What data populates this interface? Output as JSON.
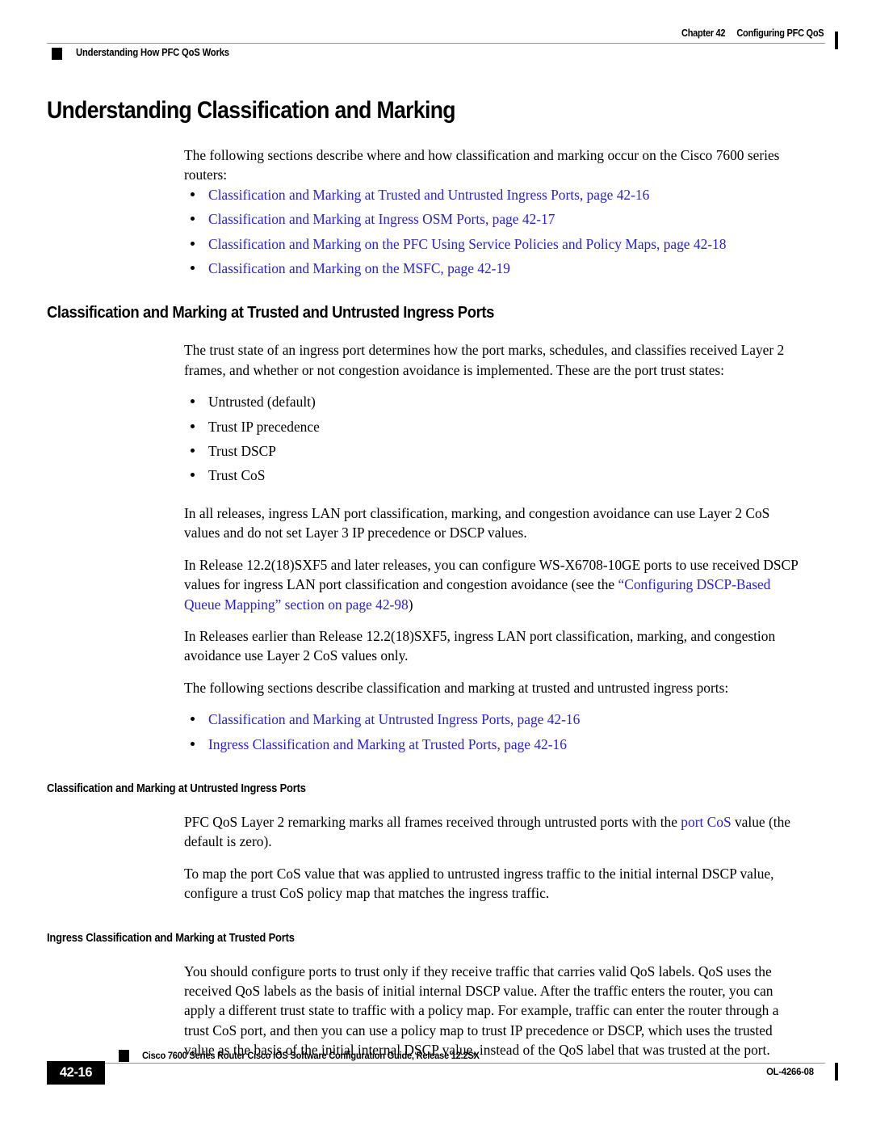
{
  "header": {
    "left_text": "Understanding How PFC QoS Works",
    "chapter_number": "Chapter 42",
    "chapter_title": "Configuring PFC QoS"
  },
  "footer": {
    "page_number": "42-16",
    "guide_title": "Cisco 7600 Series Router Cisco IOS Software Configuration Guide, Release 12.2SX",
    "doc_id": "OL-4266-08"
  },
  "main": {
    "section_title": "Understanding Classification and Marking",
    "intro_paragraph": "The following sections describe where and how classification and marking occur on the Cisco 7600 series routers:",
    "intro_links": [
      "Classification and Marking at Trusted and Untrusted Ingress Ports, page 42-16",
      "Classification and Marking at Ingress OSM Ports, page 42-17",
      "Classification and Marking on the PFC Using Service Policies and Policy Maps, page 42-18",
      "Classification and Marking on the MSFC, page 42-19"
    ],
    "trusted_untrusted": {
      "title": "Classification and Marking at Trusted and Untrusted Ingress Ports",
      "para_1": "The trust state of an ingress port determines how the port marks, schedules, and classifies received Layer 2 frames, and whether or not congestion avoidance is implemented. These are the port trust states:",
      "trust_states": [
        "Untrusted (default)",
        "Trust IP precedence",
        "Trust DSCP",
        "Trust CoS"
      ],
      "para_2": "In all releases, ingress LAN port classification, marking, and congestion avoidance can use Layer 2 CoS values and do not set Layer 3 IP precedence or DSCP values.",
      "para_3_pre": "In Release 12.2(18)SXF5 and later releases, you can configure WS-X6708-10GE ports to use received DSCP values for ingress LAN port classification and congestion avoidance (see the ",
      "para_3_link": "“Configuring DSCP-Based Queue Mapping” section on page 42-98",
      "para_3_post": ")",
      "para_4": "In Releases earlier than Release 12.2(18)SXF5, ingress LAN port classification, marking, and congestion avoidance use Layer 2 CoS values only.",
      "para_5": "The following sections describe classification and marking at trusted and untrusted ingress ports:",
      "sub_links": [
        "Classification and Marking at Untrusted Ingress Ports, page 42-16",
        "Ingress Classification and Marking at Trusted Ports, page 42-16"
      ]
    },
    "untrusted_ingress": {
      "title": "Classification and Marking at Untrusted Ingress Ports",
      "para_1_pre": "PFC QoS Layer 2 remarking marks all frames received through untrusted ports with the ",
      "para_1_link": "port CoS",
      "para_1_post": " value (the default is zero).",
      "para_2": "To map the port CoS value that was applied to untrusted ingress traffic to the initial internal DSCP value, configure a trust CoS policy map that matches the ingress traffic."
    },
    "trusted_ports": {
      "title": "Ingress Classification and Marking at Trusted Ports",
      "para_1": "You should configure ports to trust only if they receive traffic that carries valid QoS labels. QoS uses the received QoS labels as the basis of initial internal DSCP value. After the traffic enters the router, you can apply a different trust state to traffic with a policy map. For example, traffic can enter the router through a trust CoS port, and then you can use a policy map to trust IP precedence or DSCP, which uses the trusted value as the basis of the initial internal DSCP value, instead of the QoS label that was trusted at the port."
    }
  },
  "colors": {
    "link_blue": "#2a23c8",
    "rule_gray": "#939393"
  }
}
